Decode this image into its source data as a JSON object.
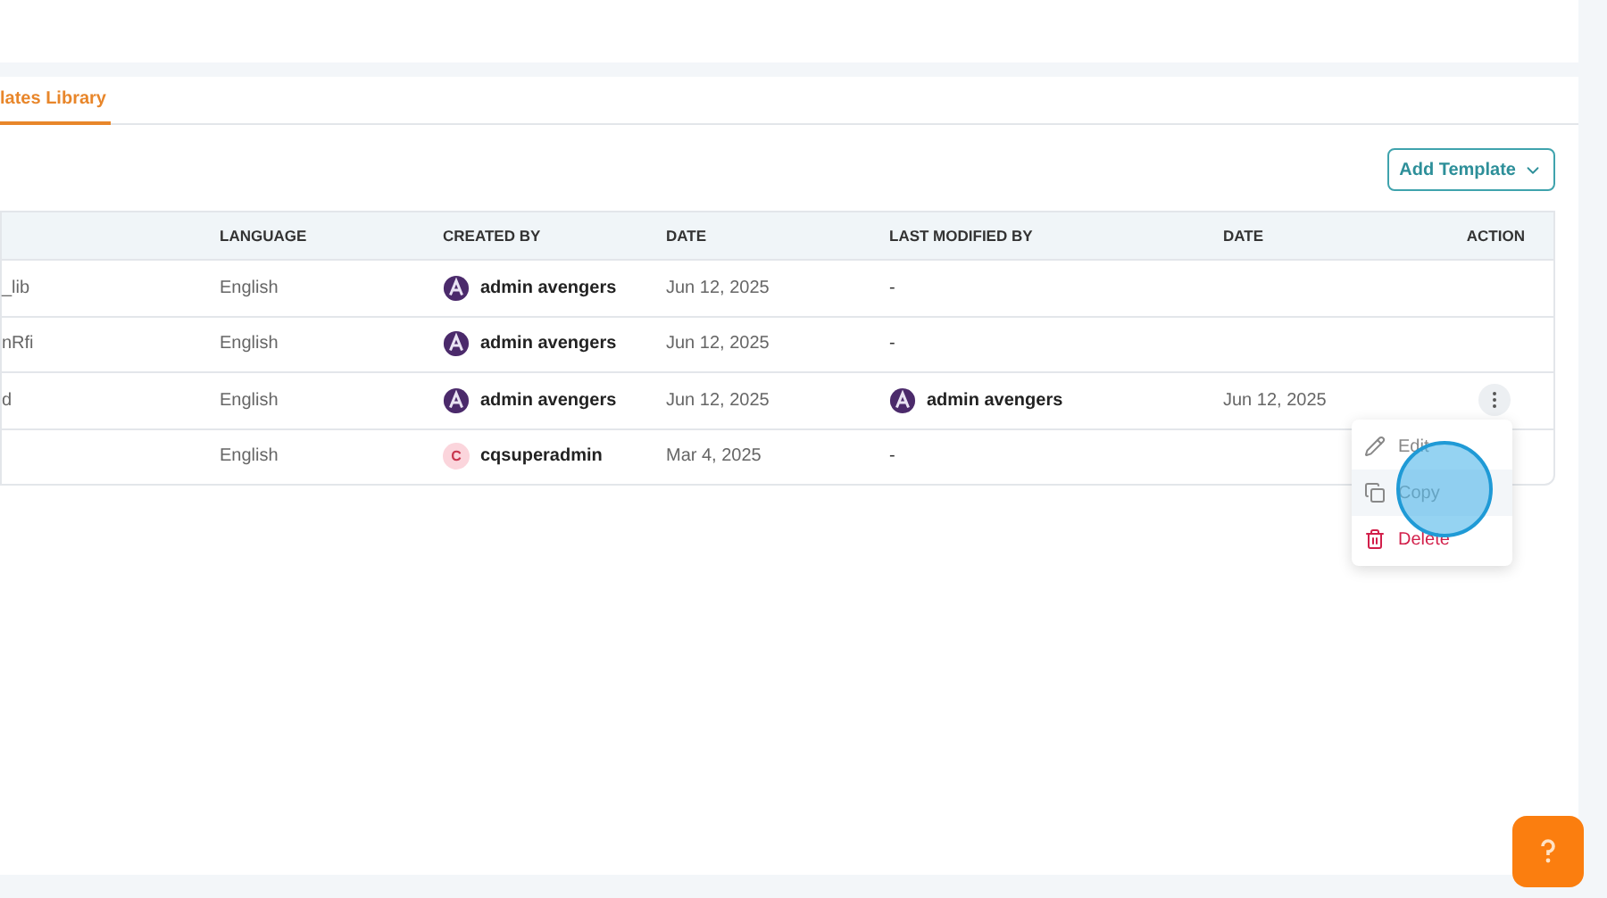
{
  "tabs": [
    {
      "label": "lates Library",
      "selected": true
    }
  ],
  "add_button": {
    "label": "Add Template"
  },
  "table": {
    "columns": [
      "LANGUAGE",
      "CREATED BY",
      "DATE",
      "LAST MODIFIED BY",
      "DATE",
      "ACTION"
    ],
    "rows": [
      {
        "column_1": "_lib",
        "language": "English",
        "created_by": {
          "name": "admin avengers",
          "kind": "logo"
        },
        "date": "Jun 12, 2025",
        "last_modified_by": {
          "name": "-"
        },
        "menu_open": false
      },
      {
        "column_1": "nRfi",
        "language": "English",
        "created_by": {
          "name": "admin avengers",
          "kind": "logo"
        },
        "date": "Jun 12, 2025",
        "last_modified_by": {
          "name": "-"
        },
        "menu_open": false
      },
      {
        "column_1": "d",
        "language": "English",
        "created_by": {
          "name": "admin avengers",
          "kind": "logo"
        },
        "date": "Jun 12, 2025",
        "last_modified_by": {
          "name": "admin avengers",
          "kind": "logo"
        },
        "modified_date": "Jun 12, 2025",
        "menu_open": true
      },
      {
        "language": "English",
        "created_by": {
          "name": "cqsuperadmin",
          "kind": "initial",
          "initial": "C"
        },
        "date": "Mar 4, 2025",
        "last_modified_by": {
          "name": "-"
        },
        "menu_open": false
      }
    ]
  },
  "action_menu": [
    {
      "label": "Edit",
      "kind": "edit",
      "selected": false
    },
    {
      "label": "Copy",
      "kind": "copy",
      "selected": true
    },
    {
      "label": "Delete",
      "kind": "delete",
      "selected": false
    }
  ]
}
